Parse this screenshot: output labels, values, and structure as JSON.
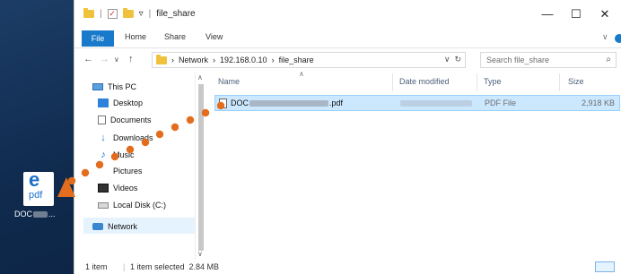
{
  "desktop": {
    "file_icon_glyph": "e",
    "file_icon_text": "pdf",
    "file_label_prefix": "DOC",
    "file_label_suffix": "..."
  },
  "window": {
    "title": "file_share",
    "qat_separator": "|",
    "qat_dropdown": "▿",
    "minimize": "—",
    "maximize": "☐",
    "close": "✕"
  },
  "ribbon": {
    "tabs": [
      "File",
      "Home",
      "Share",
      "View"
    ],
    "expand": "∨"
  },
  "address": {
    "back": "←",
    "forward": "→",
    "recent": "∨",
    "up": "↑",
    "crumbs": [
      "Network",
      "192.168.0.10",
      "file_share"
    ],
    "separator": "›",
    "dropdown": "∨",
    "refresh": "↻",
    "search_placeholder": "Search file_share",
    "search_icon": "⌕"
  },
  "nav": {
    "items": [
      {
        "label": "This PC",
        "icon": "pc-icon"
      },
      {
        "label": "Desktop",
        "icon": "desktop-folder-icon"
      },
      {
        "label": "Documents",
        "icon": "documents-icon"
      },
      {
        "label": "Downloads",
        "icon": "downloads-icon"
      },
      {
        "label": "Music",
        "icon": "music-icon"
      },
      {
        "label": "Pictures",
        "icon": "pictures-icon"
      },
      {
        "label": "Videos",
        "icon": "videos-icon"
      },
      {
        "label": "Local Disk (C:)",
        "icon": "local-disk-icon"
      },
      {
        "label": "Network",
        "icon": "network-icon"
      }
    ],
    "scroll_up": "∧",
    "scroll_down": "∨"
  },
  "list": {
    "sort_indicator": "∧",
    "columns": [
      "Name",
      "Date modified",
      "Type",
      "Size"
    ],
    "rows": [
      {
        "name_prefix": "DOC",
        "name_suffix": ".pdf",
        "type": "PDF File",
        "size": "2,918 KB"
      }
    ]
  },
  "status": {
    "item_count": "1 item",
    "selection": "1 item selected  2.84 MB"
  },
  "colors": {
    "file_tab": "#1979ca",
    "selection": "#cce8ff",
    "drag_path": "#e36d1e"
  }
}
